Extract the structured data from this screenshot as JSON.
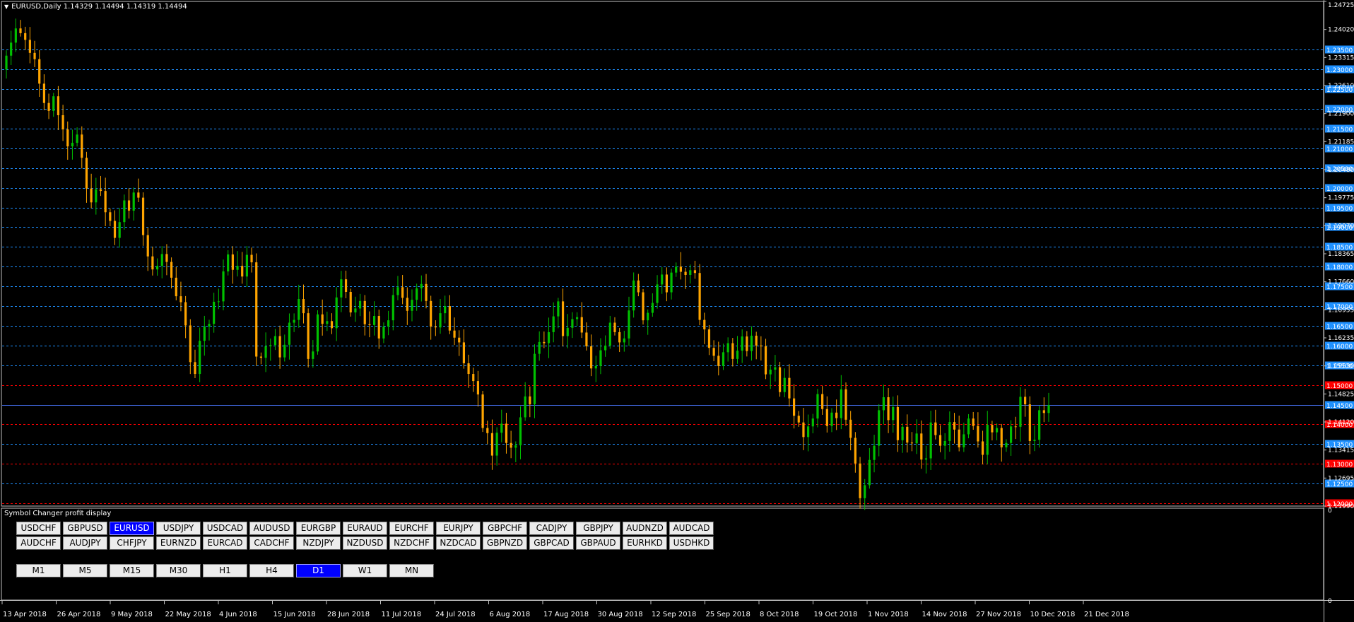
{
  "chart": {
    "title": "EURUSD,Daily  1.14329 1.14494 1.14319 1.14494",
    "indicator_title": "Symbol Changer profit display",
    "price_labels": [
      "1.24725",
      "1.24020",
      "1.23315",
      "1.22610",
      "1.21900",
      "1.21185",
      "1.20480",
      "1.19775",
      "1.19070",
      "1.18365",
      "1.17660",
      "1.16955",
      "1.16235",
      "1.15530",
      "1.14825",
      "1.14120",
      "1.13415",
      "1.12695",
      "1.11990"
    ],
    "level_labels": [
      {
        "value": 1.235,
        "text": "1.23500",
        "color": "#1e90ff"
      },
      {
        "value": 1.23,
        "text": "1.23000",
        "color": "#1e90ff"
      },
      {
        "value": 1.225,
        "text": "1.22500",
        "color": "#1e90ff"
      },
      {
        "value": 1.22,
        "text": "1.22000",
        "color": "#1e90ff"
      },
      {
        "value": 1.215,
        "text": "1.21500",
        "color": "#1e90ff"
      },
      {
        "value": 1.21,
        "text": "1.21000",
        "color": "#1e90ff"
      },
      {
        "value": 1.205,
        "text": "1.20500",
        "color": "#1e90ff"
      },
      {
        "value": 1.2,
        "text": "1.20000",
        "color": "#1e90ff"
      },
      {
        "value": 1.195,
        "text": "1.19500",
        "color": "#1e90ff"
      },
      {
        "value": 1.19,
        "text": "1.19000",
        "color": "#1e90ff"
      },
      {
        "value": 1.185,
        "text": "1.18500",
        "color": "#1e90ff"
      },
      {
        "value": 1.18,
        "text": "1.18000",
        "color": "#1e90ff"
      },
      {
        "value": 1.175,
        "text": "1.17500",
        "color": "#1e90ff"
      },
      {
        "value": 1.17,
        "text": "1.17000",
        "color": "#1e90ff"
      },
      {
        "value": 1.165,
        "text": "1.16500",
        "color": "#1e90ff"
      },
      {
        "value": 1.16,
        "text": "1.16000",
        "color": "#1e90ff"
      },
      {
        "value": 1.155,
        "text": "1.15500",
        "color": "#1e90ff"
      },
      {
        "value": 1.15,
        "text": "1.15000",
        "color": "#ff0000"
      },
      {
        "value": 1.14494,
        "text": "1.14500",
        "color": "#1e90ff"
      },
      {
        "value": 1.14,
        "text": "1.14000",
        "color": "#ff0000"
      },
      {
        "value": 1.135,
        "text": "1.13500",
        "color": "#1e90ff"
      },
      {
        "value": 1.13,
        "text": "1.13000",
        "color": "#ff0000"
      },
      {
        "value": 1.125,
        "text": "1.12500",
        "color": "#1e90ff"
      },
      {
        "value": 1.12,
        "text": "1.12000",
        "color": "#ff0000"
      }
    ],
    "date_labels": [
      "13 Apr 2018",
      "26 Apr 2018",
      "9 May 2018",
      "22 May 2018",
      "4 Jun 2018",
      "15 Jun 2018",
      "28 Jun 2018",
      "11 Jul 2018",
      "24 Jul 2018",
      "6 Aug 2018",
      "17 Aug 2018",
      "30 Aug 2018",
      "12 Sep 2018",
      "25 Sep 2018",
      "8 Oct 2018",
      "19 Oct 2018",
      "1 Nov 2018",
      "14 Nov 2018",
      "27 Nov 2018",
      "10 Dec 2018",
      "21 Dec 2018"
    ],
    "subwindow_labels": [
      "0",
      "0"
    ],
    "colors": {
      "bull": "#00c000",
      "bear": "#ffa500",
      "grid": "#1e90ff",
      "red_level": "#ff0000",
      "current": "#4169e1"
    },
    "closes": [
      1.2335,
      1.2368,
      1.2404,
      1.2392,
      1.2375,
      1.2342,
      1.2326,
      1.2264,
      1.2215,
      1.2195,
      1.2232,
      1.2184,
      1.2148,
      1.2105,
      1.2114,
      1.2135,
      1.2076,
      1.1998,
      1.1963,
      1.1996,
      1.1992,
      1.1938,
      1.1916,
      1.1873,
      1.1913,
      1.1968,
      1.1942,
      1.1988,
      1.1975,
      1.188,
      1.1826,
      1.1793,
      1.1802,
      1.1832,
      1.1812,
      1.1772,
      1.1725,
      1.171,
      1.1651,
      1.1558,
      1.1528,
      1.1612,
      1.1648,
      1.1655,
      1.1711,
      1.1712,
      1.1788,
      1.1831,
      1.1792,
      1.1802,
      1.1775,
      1.183,
      1.1811,
      1.1572,
      1.1569,
      1.1598,
      1.1601,
      1.1624,
      1.157,
      1.1602,
      1.1658,
      1.1665,
      1.1718,
      1.1682,
      1.1566,
      1.1585,
      1.1679,
      1.1655,
      1.1662,
      1.1644,
      1.1722,
      1.1768,
      1.1736,
      1.1684,
      1.1694,
      1.1713,
      1.1654,
      1.1652,
      1.1675,
      1.1618,
      1.1648,
      1.1664,
      1.1728,
      1.1748,
      1.1721,
      1.1688,
      1.1716,
      1.1745,
      1.1756,
      1.1713,
      1.1648,
      1.1646,
      1.1682,
      1.17,
      1.1638,
      1.162,
      1.1608,
      1.1555,
      1.1528,
      1.151,
      1.1476,
      1.1391,
      1.1378,
      1.1321,
      1.1379,
      1.1402,
      1.1353,
      1.1341,
      1.1347,
      1.1418,
      1.1471,
      1.1451,
      1.1579,
      1.1609,
      1.1606,
      1.1634,
      1.1674,
      1.1712,
      1.1624,
      1.1645,
      1.1667,
      1.1672,
      1.1633,
      1.1598,
      1.1542,
      1.1548,
      1.1588,
      1.16,
      1.1658,
      1.1634,
      1.1608,
      1.1618,
      1.1689,
      1.1765,
      1.1735,
      1.1664,
      1.1683,
      1.1708,
      1.1755,
      1.178,
      1.1735,
      1.1785,
      1.18,
      1.1787,
      1.1779,
      1.1791,
      1.1784,
      1.1665,
      1.1641,
      1.1594,
      1.1574,
      1.1548,
      1.1583,
      1.1606,
      1.1566,
      1.1587,
      1.1623,
      1.1586,
      1.1625,
      1.16,
      1.1598,
      1.1527,
      1.1539,
      1.1545,
      1.1482,
      1.1518,
      1.1466,
      1.1422,
      1.1405,
      1.1368,
      1.1395,
      1.1415,
      1.1477,
      1.1439,
      1.1396,
      1.143,
      1.1416,
      1.1489,
      1.1412,
      1.1366,
      1.1301,
      1.1213,
      1.1246,
      1.131,
      1.1346,
      1.1436,
      1.1469,
      1.1411,
      1.1444,
      1.136,
      1.1394,
      1.1354,
      1.1352,
      1.1377,
      1.1311,
      1.1314,
      1.1405,
      1.1373,
      1.1346,
      1.1358,
      1.1406,
      1.1387,
      1.1342,
      1.1375,
      1.1415,
      1.1396,
      1.1357,
      1.1323,
      1.1399,
      1.138,
      1.1391,
      1.1342,
      1.1353,
      1.1395,
      1.1394,
      1.147,
      1.1451,
      1.1358,
      1.1361,
      1.1436,
      1.1429,
      1.1449
    ]
  },
  "symbols": {
    "row1": [
      "USDCHF",
      "GBPUSD",
      "EURUSD",
      "USDJPY",
      "USDCAD",
      "AUDUSD",
      "EURGBP",
      "EURAUD",
      "EURCHF",
      "EURJPY",
      "GBPCHF",
      "CADJPY",
      "GBPJPY",
      "AUDNZD",
      "AUDCAD"
    ],
    "row2": [
      "AUDCHF",
      "AUDJPY",
      "CHFJPY",
      "EURNZD",
      "EURCAD",
      "CADCHF",
      "NZDJPY",
      "NZDUSD",
      "NZDCHF",
      "NZDCAD",
      "GBPNZD",
      "GBPCAD",
      "GBPAUD",
      "EURHKD",
      "USDHKD"
    ],
    "active": "EURUSD"
  },
  "timeframes": {
    "items": [
      "M1",
      "M5",
      "M15",
      "M30",
      "H1",
      "H4",
      "D1",
      "W1",
      "MN"
    ],
    "active": "D1"
  }
}
